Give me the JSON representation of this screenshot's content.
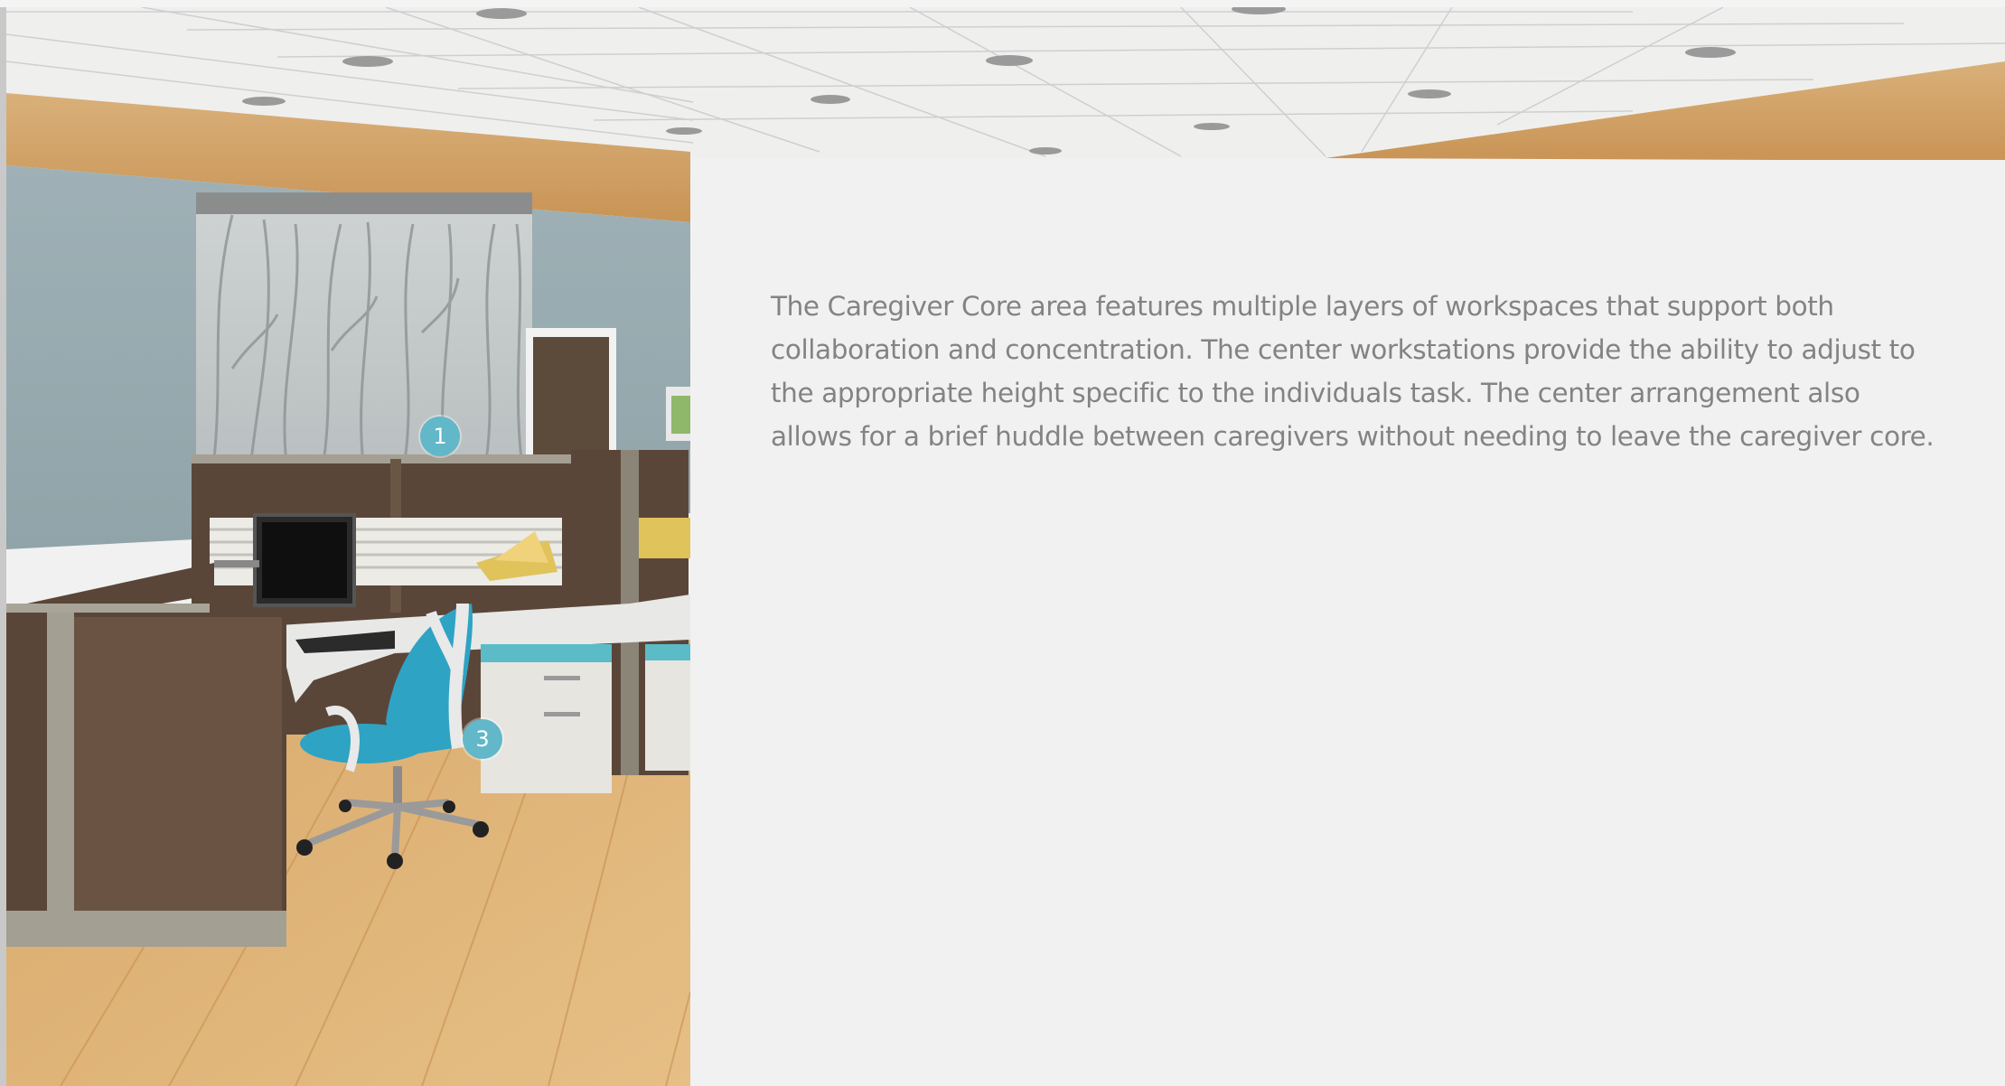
{
  "description": {
    "text": "The Caregiver Core area features multiple layers of workspaces that support both collaboration and concentration. The center workstations provide the ability to adjust to the appropriate height specific to the individuals task. The center arrangement also allows for a brief huddle between caregivers without needing to leave the caregiver core."
  },
  "hotspots": [
    {
      "label": "1"
    },
    {
      "label": "3"
    }
  ]
}
